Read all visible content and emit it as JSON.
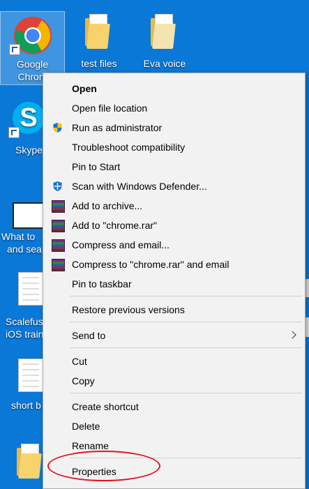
{
  "desktop": {
    "icons": [
      {
        "label_line1": "Google",
        "label_line2": "Chrom"
      },
      {
        "label": "test files"
      },
      {
        "label": "Eva voice"
      },
      {
        "label": "Skype"
      },
      {
        "label_line1": "What to",
        "label_line2": "and sea"
      },
      {
        "label_line1": "Scalefus",
        "label_line2": "iOS train"
      },
      {
        "label": "short b"
      }
    ]
  },
  "context_menu": {
    "items": [
      {
        "label": "Open"
      },
      {
        "label": "Open file location"
      },
      {
        "label": "Run as administrator"
      },
      {
        "label": "Troubleshoot compatibility"
      },
      {
        "label": "Pin to Start"
      },
      {
        "label": "Scan with Windows Defender..."
      },
      {
        "label": "Add to archive..."
      },
      {
        "label": "Add to \"chrome.rar\""
      },
      {
        "label": "Compress and email..."
      },
      {
        "label": "Compress to \"chrome.rar\" and email"
      },
      {
        "label": "Pin to taskbar"
      },
      {
        "label": "Restore previous versions"
      },
      {
        "label": "Send to"
      },
      {
        "label": "Cut"
      },
      {
        "label": "Copy"
      },
      {
        "label": "Create shortcut"
      },
      {
        "label": "Delete"
      },
      {
        "label": "Rename"
      },
      {
        "label": "Properties"
      }
    ]
  },
  "colors": {
    "desktop_bg": "#0a78d7",
    "highlight_ring": "#e0151f"
  }
}
